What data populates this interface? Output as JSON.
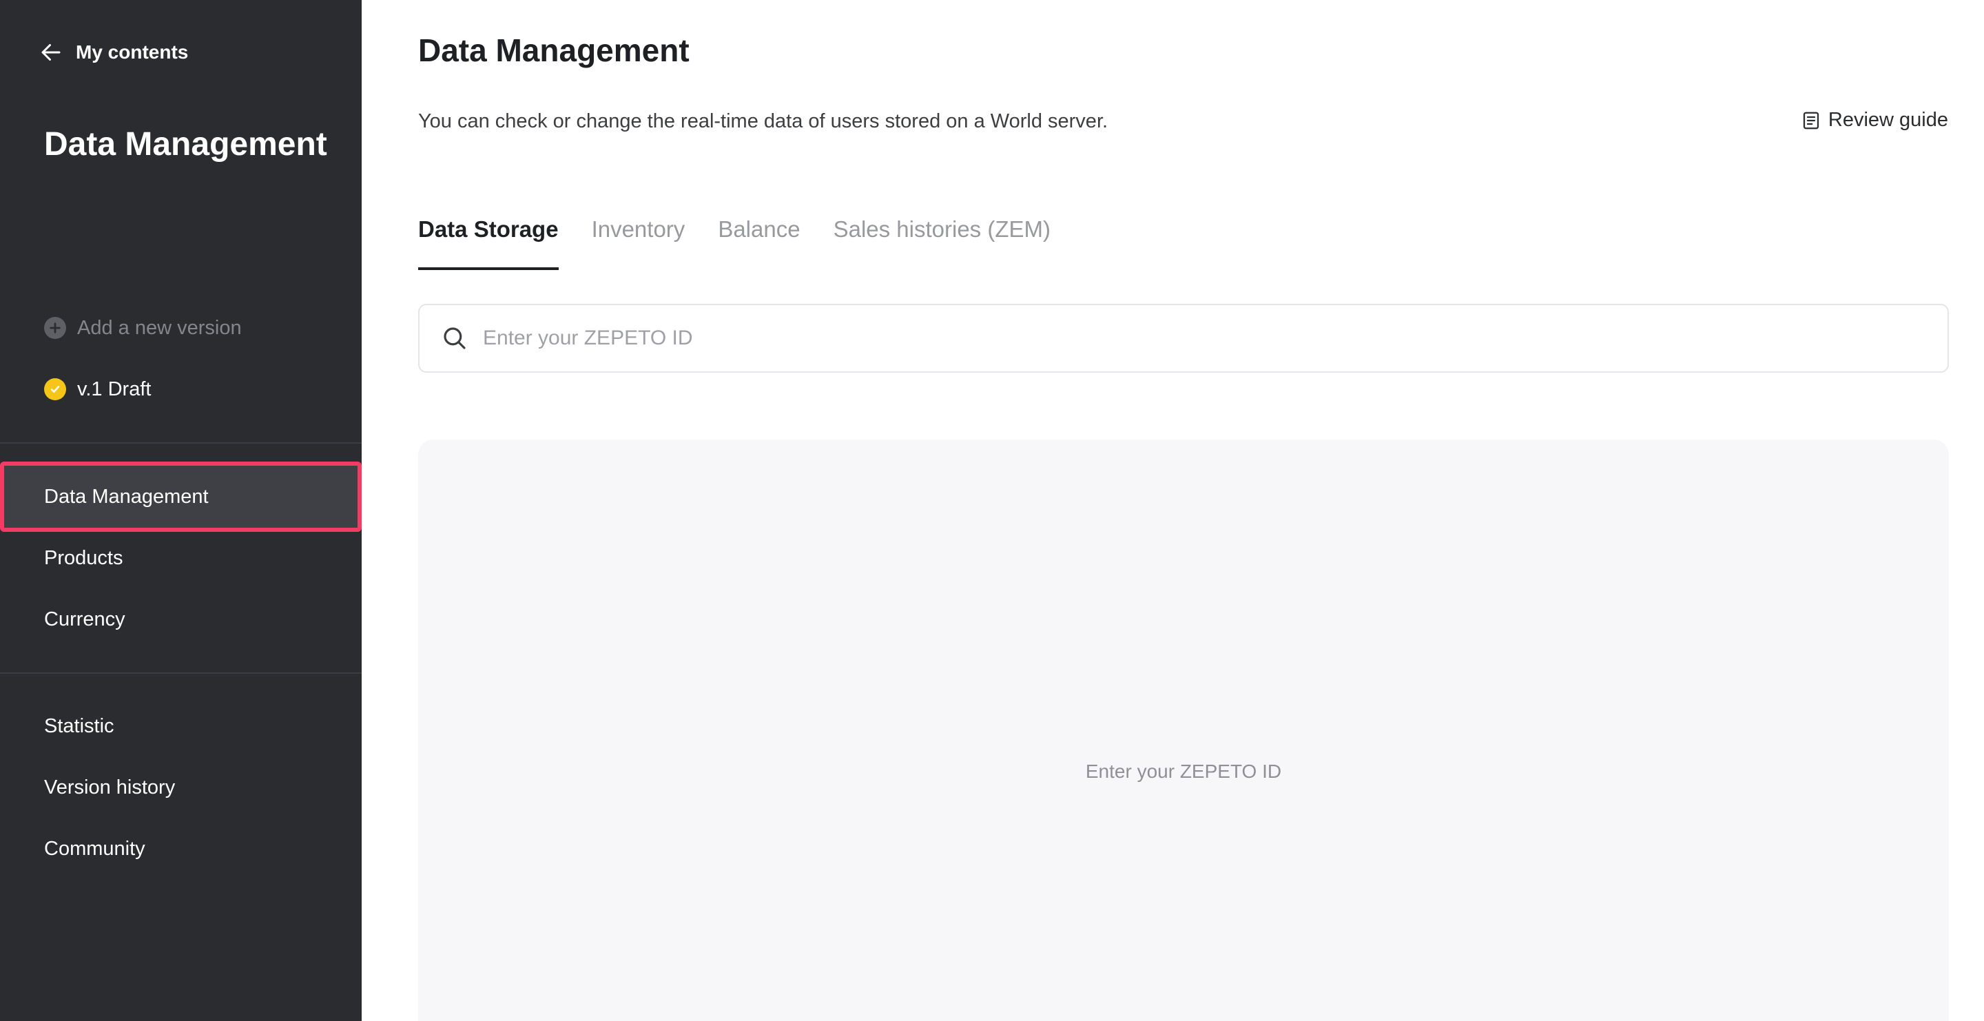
{
  "sidebar": {
    "back_label": "My contents",
    "title": "Data Management",
    "versions": {
      "add_label": "Add a new version",
      "draft_label": "v.1 Draft"
    },
    "nav_primary": [
      {
        "label": "Data Management",
        "active": true
      },
      {
        "label": "Products",
        "active": false
      },
      {
        "label": "Currency",
        "active": false
      }
    ],
    "nav_secondary": [
      {
        "label": "Statistic"
      },
      {
        "label": "Version history"
      },
      {
        "label": "Community"
      }
    ]
  },
  "main": {
    "title": "Data Management",
    "description": "You can check or change the real-time data of users stored on a World server.",
    "review_guide_label": "Review guide",
    "tabs": [
      {
        "label": "Data Storage",
        "active": true
      },
      {
        "label": "Inventory",
        "active": false
      },
      {
        "label": "Balance",
        "active": false
      },
      {
        "label": "Sales histories (ZEM)",
        "active": false
      }
    ],
    "search": {
      "placeholder": "Enter your ZEPETO ID",
      "value": ""
    },
    "empty_state_message": "Enter your ZEPETO ID"
  },
  "colors": {
    "sidebar_bg": "#2b2c30",
    "active_outline": "#f23c63",
    "draft_badge": "#f5c518",
    "text_primary": "#1f2024",
    "text_muted": "#98999e",
    "panel_bg": "#f7f7f9"
  },
  "icons": {
    "back": "arrow-left-icon",
    "add": "plus-circle-icon",
    "draft": "check-circle-icon",
    "guide": "document-icon",
    "search": "search-icon"
  }
}
